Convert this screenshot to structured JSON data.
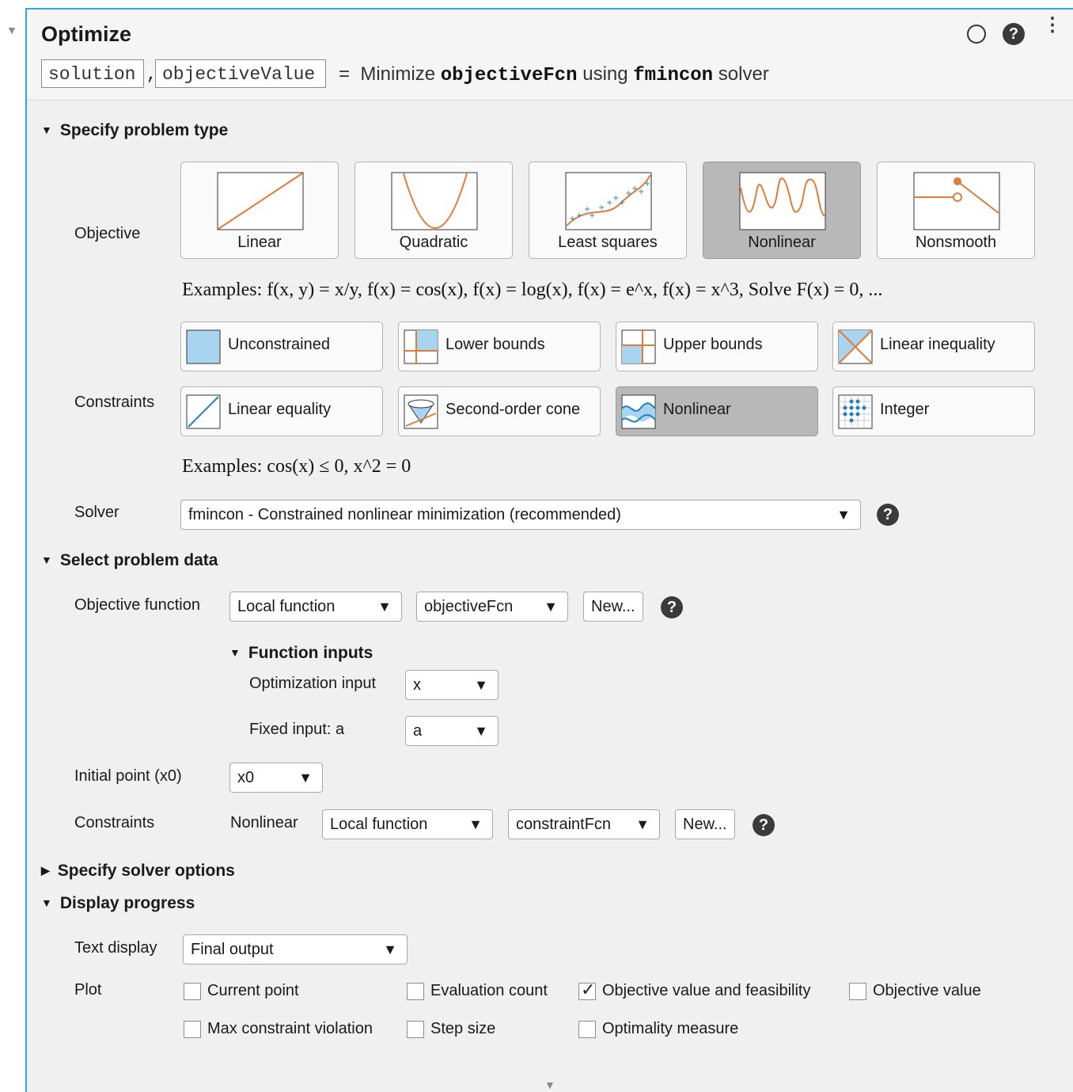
{
  "header": {
    "title": "Optimize",
    "outputs": [
      "solution",
      "objectiveValue"
    ],
    "separator": ",",
    "equals": "=",
    "summary_pre": "Minimize",
    "summary_fcn": "objectiveFcn",
    "summary_mid": "using",
    "summary_solver": "fmincon",
    "summary_post": "solver"
  },
  "sections": {
    "problem_type": "Specify problem type",
    "problem_data": "Select problem data",
    "solver_options": "Specify solver options",
    "display_progress": "Display progress"
  },
  "objective": {
    "label": "Objective",
    "types": [
      {
        "label": "Linear",
        "selected": false
      },
      {
        "label": "Quadratic",
        "selected": false
      },
      {
        "label": "Least squares",
        "selected": false
      },
      {
        "label": "Nonlinear",
        "selected": true
      },
      {
        "label": "Nonsmooth",
        "selected": false
      }
    ],
    "examples": "Examples: f(x, y) = x/y, f(x) = cos(x), f(x) = log(x), f(x) = e^x, f(x) = x^3, Solve F(x) = 0, ..."
  },
  "constraints": {
    "label": "Constraints",
    "types": [
      {
        "label": "Unconstrained",
        "selected": false
      },
      {
        "label": "Lower bounds",
        "selected": false
      },
      {
        "label": "Upper bounds",
        "selected": false
      },
      {
        "label": "Linear inequality",
        "selected": false
      },
      {
        "label": "Linear equality",
        "selected": false
      },
      {
        "label": "Second-order cone",
        "selected": false
      },
      {
        "label": "Nonlinear",
        "selected": true
      },
      {
        "label": "Integer",
        "selected": false
      }
    ],
    "examples": "Examples: cos(x) ≤ 0, x^2 = 0"
  },
  "solver": {
    "label": "Solver",
    "value": "fmincon - Constrained nonlinear minimization (recommended)"
  },
  "problem_data": {
    "objective_function_label": "Objective function",
    "objective_source": "Local function",
    "objective_name": "objectiveFcn",
    "new_label": "New...",
    "function_inputs_title": "Function inputs",
    "optimization_input_label": "Optimization input",
    "optimization_input_value": "x",
    "fixed_input_label": "Fixed input: a",
    "fixed_input_value": "a",
    "initial_point_label": "Initial point (x0)",
    "initial_point_value": "x0",
    "constraints_label": "Constraints",
    "nonlinear_label": "Nonlinear",
    "constraint_source": "Local function",
    "constraint_name": "constraintFcn"
  },
  "display": {
    "text_display_label": "Text display",
    "text_display_value": "Final output",
    "plot_label": "Plot",
    "plots": [
      {
        "label": "Current point",
        "checked": false
      },
      {
        "label": "Evaluation count",
        "checked": false
      },
      {
        "label": "Objective value and feasibility",
        "checked": true
      },
      {
        "label": "Objective value",
        "checked": false
      },
      {
        "label": "Max constraint violation",
        "checked": false
      },
      {
        "label": "Step size",
        "checked": false
      },
      {
        "label": "Optimality measure",
        "checked": false
      }
    ]
  },
  "colors": {
    "accent": "#33a6e0",
    "curve": "#e07b39",
    "marker": "#1f7fc0",
    "selected": "#b8b8b8"
  },
  "icons": [
    "collapse-caret-icon",
    "circle-icon",
    "help-icon",
    "more-options-icon",
    "expand-more-icon"
  ]
}
